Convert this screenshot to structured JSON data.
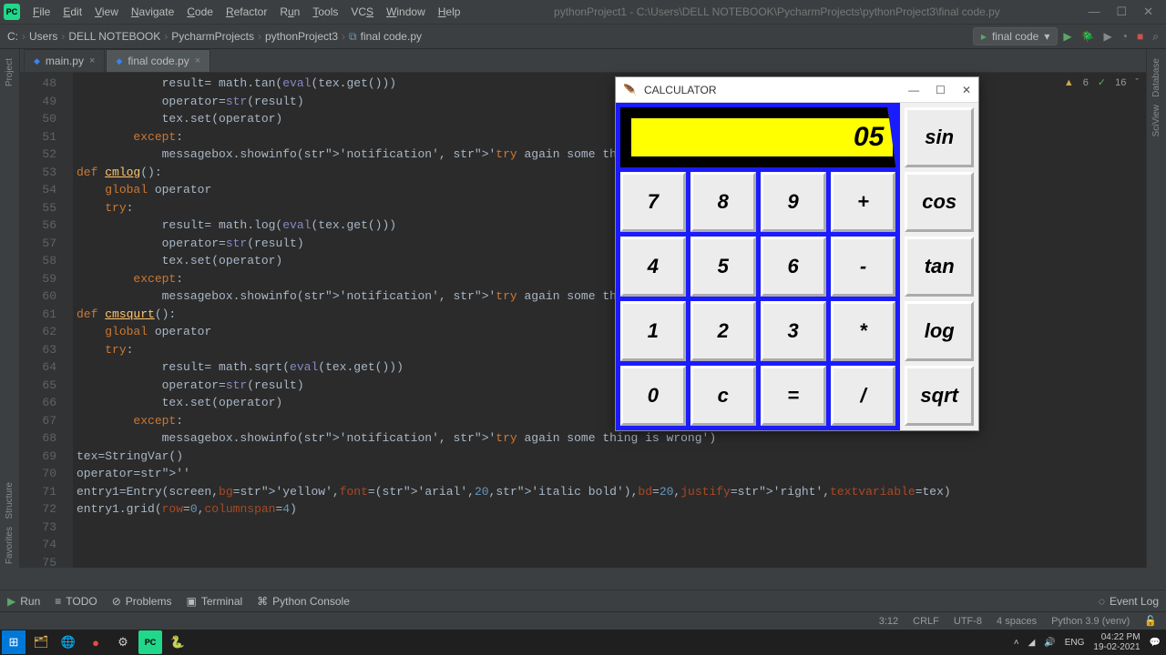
{
  "app": {
    "title": "pythonProject1 - C:\\Users\\DELL NOTEBOOK\\PycharmProjects\\pythonProject3\\final code.py"
  },
  "menu": {
    "file": "File",
    "edit": "Edit",
    "view": "View",
    "navigate": "Navigate",
    "code": "Code",
    "refactor": "Refactor",
    "run": "Run",
    "tools": "Tools",
    "vcs": "VCS",
    "window": "Window",
    "help": "Help"
  },
  "breadcrumb": {
    "b0": "C:",
    "b1": "Users",
    "b2": "DELL NOTEBOOK",
    "b3": "PycharmProjects",
    "b4": "pythonProject3",
    "b5": "final code.py"
  },
  "runconfig": {
    "label": "final code"
  },
  "tabs": {
    "t0": "main.py",
    "t1": "final code.py"
  },
  "inspect": {
    "warn": "6",
    "ok": "16"
  },
  "gutter": {
    "start": 48,
    "end": 75
  },
  "code": {
    "l48": "            result= math.tan(eval(tex.get()))",
    "l49": "            operator=str(result)",
    "l50": "            tex.set(operator)",
    "l51": "        except:",
    "l52": "            messagebox.showinfo('notification', 'try again some thing is wrong')",
    "l53": "def cmlog():",
    "l54": "    global operator",
    "l55": "    try:",
    "l56": "            result= math.log(eval(tex.get()))",
    "l57": "            operator=str(result)",
    "l58": "            tex.set(operator)",
    "l59": "        except:",
    "l60": "            messagebox.showinfo('notification', 'try again some thing is wrong')",
    "l61": "def cmsqurt():",
    "l62": "    global operator",
    "l63": "    try:",
    "l64": "            result= math.sqrt(eval(tex.get()))",
    "l65": "            operator=str(result)",
    "l66": "            tex.set(operator)",
    "l67": "        except:",
    "l68": "            messagebox.showinfo('notification', 'try again some thing is wrong')",
    "l69": "",
    "l70": "tex=StringVar()",
    "l71": "operator=''",
    "l72": "",
    "l73": "",
    "l74": "entry1=Entry(screen,bg='yellow',font=('arial',20,'italic bold'),bd=20,justify='right',textvariable=tex)",
    "l75": "entry1.grid(row=0,columnspan=4)"
  },
  "bottom": {
    "run": "Run",
    "todo": "TODO",
    "problems": "Problems",
    "terminal": "Terminal",
    "console": "Python Console",
    "eventlog": "Event Log"
  },
  "status": {
    "pos": "3:12",
    "crlf": "CRLF",
    "enc": "UTF-8",
    "indent": "4 spaces",
    "py": "Python 3.9 (venv)"
  },
  "taskbar": {
    "time": "04:22 PM",
    "date": "19-02-2021"
  },
  "rails": {
    "project": "Project",
    "favorites": "Favorites",
    "structure": "Structure",
    "database": "Database",
    "sciview": "SciView"
  },
  "calc": {
    "title": "CALCULATOR",
    "display": "05",
    "r0": [
      "sin"
    ],
    "r1": [
      "7",
      "8",
      "9",
      "+",
      "cos"
    ],
    "r2": [
      "4",
      "5",
      "6",
      "-",
      "tan"
    ],
    "r3": [
      "1",
      "2",
      "3",
      "*",
      "log"
    ],
    "r4": [
      "0",
      "c",
      "=",
      "/",
      "sqrt"
    ]
  }
}
